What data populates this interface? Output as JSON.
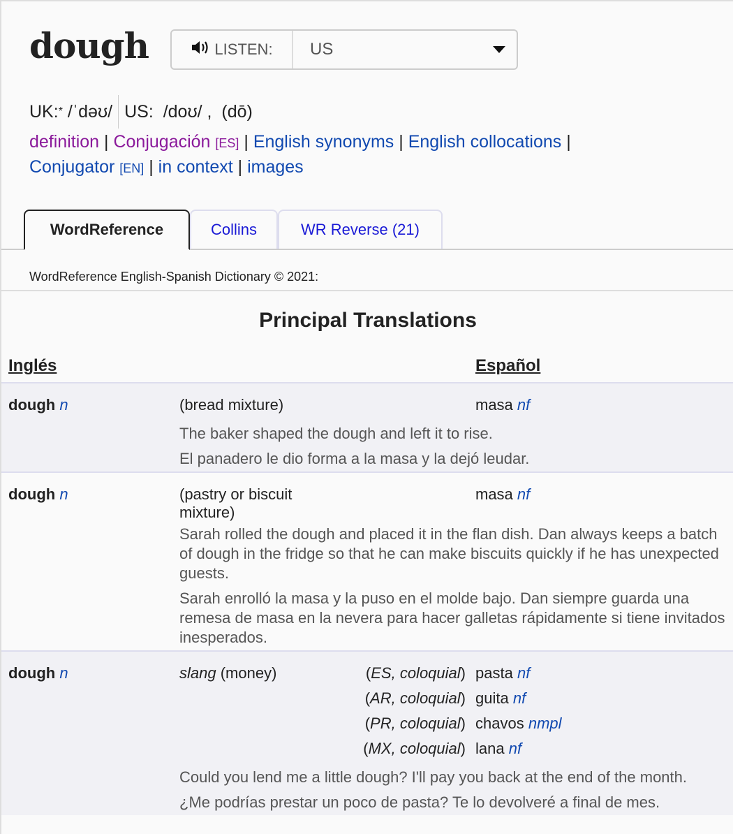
{
  "headword": "dough",
  "listen": {
    "label": "LISTEN:",
    "icon": "speaker-icon",
    "selected": "US"
  },
  "pronunciation": {
    "uk_label": "UK:",
    "uk_mark": "*",
    "uk_ipa": "/ˈdəʊ/",
    "us_label": "US:",
    "us_ipa": "/doʊ/ ,",
    "us_respell": "(dō)"
  },
  "links": [
    {
      "text": "definition",
      "tag": ""
    },
    {
      "text": "Conjugación",
      "tag": "[ES]"
    },
    {
      "text": "English synonyms",
      "tag": ""
    },
    {
      "text": "English collocations",
      "tag": ""
    },
    {
      "text": "Conjugator",
      "tag": "[EN]"
    },
    {
      "text": "in context",
      "tag": ""
    },
    {
      "text": "images",
      "tag": ""
    }
  ],
  "tabs": [
    "WordReference",
    "Collins",
    "WR Reverse (21)"
  ],
  "copyright": "WordReference English-Spanish Dictionary © 2021:",
  "section_title": "Principal Translations",
  "col_headers": {
    "english": "Inglés",
    "spanish": "Español"
  },
  "entries": [
    {
      "word": "dough",
      "pos": "n",
      "sense": "(bread mixture)",
      "sense_prefix": "",
      "translations": [
        {
          "region": "",
          "word": "masa",
          "pos": "nf"
        }
      ],
      "ex_en": "The baker shaped the dough and left it to rise.",
      "ex_es": "El panadero le dio forma a la masa y la dejó leudar."
    },
    {
      "word": "dough",
      "pos": "n",
      "sense": "(pastry or biscuit mixture)",
      "sense_prefix": "",
      "translations": [
        {
          "region": "",
          "word": "masa",
          "pos": "nf"
        }
      ],
      "ex_en": "Sarah rolled the dough and placed it in the flan dish. Dan always keeps a batch of dough in the fridge so that he can make biscuits quickly if he has unexpected guests.",
      "ex_es": "Sarah enrolló la masa y la puso en el molde bajo. Dan siempre guarda una remesa de masa en la nevera para hacer galletas rápidamente si tiene invitados inesperados."
    },
    {
      "word": "dough",
      "pos": "n",
      "sense": "(money)",
      "sense_prefix": "slang",
      "translations": [
        {
          "region": "ES, coloquial",
          "word": "pasta",
          "pos": "nf"
        },
        {
          "region": "AR, coloquial",
          "word": "guita",
          "pos": "nf"
        },
        {
          "region": "PR, coloquial",
          "word": "chavos",
          "pos": "nmpl"
        },
        {
          "region": "MX, coloquial",
          "word": "lana",
          "pos": "nf"
        }
      ],
      "ex_en": "Could you lend me a little dough? I'll pay you back at the end of the month.",
      "ex_es": "¿Me podrías prestar un poco de pasta? Te lo devolveré a final de mes."
    }
  ]
}
